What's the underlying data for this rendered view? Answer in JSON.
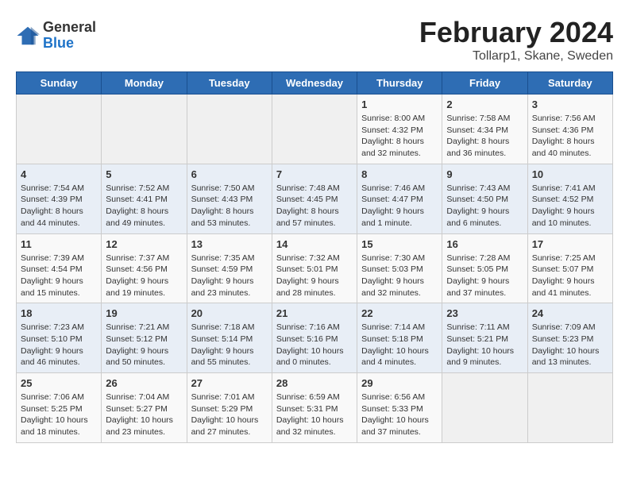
{
  "logo": {
    "general": "General",
    "blue": "Blue"
  },
  "title": "February 2024",
  "subtitle": "Tollarp1, Skane, Sweden",
  "headers": [
    "Sunday",
    "Monday",
    "Tuesday",
    "Wednesday",
    "Thursday",
    "Friday",
    "Saturday"
  ],
  "rows": [
    [
      {
        "day": "",
        "content": ""
      },
      {
        "day": "",
        "content": ""
      },
      {
        "day": "",
        "content": ""
      },
      {
        "day": "",
        "content": ""
      },
      {
        "day": "1",
        "content": "Sunrise: 8:00 AM\nSunset: 4:32 PM\nDaylight: 8 hours\nand 32 minutes."
      },
      {
        "day": "2",
        "content": "Sunrise: 7:58 AM\nSunset: 4:34 PM\nDaylight: 8 hours\nand 36 minutes."
      },
      {
        "day": "3",
        "content": "Sunrise: 7:56 AM\nSunset: 4:36 PM\nDaylight: 8 hours\nand 40 minutes."
      }
    ],
    [
      {
        "day": "4",
        "content": "Sunrise: 7:54 AM\nSunset: 4:39 PM\nDaylight: 8 hours\nand 44 minutes."
      },
      {
        "day": "5",
        "content": "Sunrise: 7:52 AM\nSunset: 4:41 PM\nDaylight: 8 hours\nand 49 minutes."
      },
      {
        "day": "6",
        "content": "Sunrise: 7:50 AM\nSunset: 4:43 PM\nDaylight: 8 hours\nand 53 minutes."
      },
      {
        "day": "7",
        "content": "Sunrise: 7:48 AM\nSunset: 4:45 PM\nDaylight: 8 hours\nand 57 minutes."
      },
      {
        "day": "8",
        "content": "Sunrise: 7:46 AM\nSunset: 4:47 PM\nDaylight: 9 hours\nand 1 minute."
      },
      {
        "day": "9",
        "content": "Sunrise: 7:43 AM\nSunset: 4:50 PM\nDaylight: 9 hours\nand 6 minutes."
      },
      {
        "day": "10",
        "content": "Sunrise: 7:41 AM\nSunset: 4:52 PM\nDaylight: 9 hours\nand 10 minutes."
      }
    ],
    [
      {
        "day": "11",
        "content": "Sunrise: 7:39 AM\nSunset: 4:54 PM\nDaylight: 9 hours\nand 15 minutes."
      },
      {
        "day": "12",
        "content": "Sunrise: 7:37 AM\nSunset: 4:56 PM\nDaylight: 9 hours\nand 19 minutes."
      },
      {
        "day": "13",
        "content": "Sunrise: 7:35 AM\nSunset: 4:59 PM\nDaylight: 9 hours\nand 23 minutes."
      },
      {
        "day": "14",
        "content": "Sunrise: 7:32 AM\nSunset: 5:01 PM\nDaylight: 9 hours\nand 28 minutes."
      },
      {
        "day": "15",
        "content": "Sunrise: 7:30 AM\nSunset: 5:03 PM\nDaylight: 9 hours\nand 32 minutes."
      },
      {
        "day": "16",
        "content": "Sunrise: 7:28 AM\nSunset: 5:05 PM\nDaylight: 9 hours\nand 37 minutes."
      },
      {
        "day": "17",
        "content": "Sunrise: 7:25 AM\nSunset: 5:07 PM\nDaylight: 9 hours\nand 41 minutes."
      }
    ],
    [
      {
        "day": "18",
        "content": "Sunrise: 7:23 AM\nSunset: 5:10 PM\nDaylight: 9 hours\nand 46 minutes."
      },
      {
        "day": "19",
        "content": "Sunrise: 7:21 AM\nSunset: 5:12 PM\nDaylight: 9 hours\nand 50 minutes."
      },
      {
        "day": "20",
        "content": "Sunrise: 7:18 AM\nSunset: 5:14 PM\nDaylight: 9 hours\nand 55 minutes."
      },
      {
        "day": "21",
        "content": "Sunrise: 7:16 AM\nSunset: 5:16 PM\nDaylight: 10 hours\nand 0 minutes."
      },
      {
        "day": "22",
        "content": "Sunrise: 7:14 AM\nSunset: 5:18 PM\nDaylight: 10 hours\nand 4 minutes."
      },
      {
        "day": "23",
        "content": "Sunrise: 7:11 AM\nSunset: 5:21 PM\nDaylight: 10 hours\nand 9 minutes."
      },
      {
        "day": "24",
        "content": "Sunrise: 7:09 AM\nSunset: 5:23 PM\nDaylight: 10 hours\nand 13 minutes."
      }
    ],
    [
      {
        "day": "25",
        "content": "Sunrise: 7:06 AM\nSunset: 5:25 PM\nDaylight: 10 hours\nand 18 minutes."
      },
      {
        "day": "26",
        "content": "Sunrise: 7:04 AM\nSunset: 5:27 PM\nDaylight: 10 hours\nand 23 minutes."
      },
      {
        "day": "27",
        "content": "Sunrise: 7:01 AM\nSunset: 5:29 PM\nDaylight: 10 hours\nand 27 minutes."
      },
      {
        "day": "28",
        "content": "Sunrise: 6:59 AM\nSunset: 5:31 PM\nDaylight: 10 hours\nand 32 minutes."
      },
      {
        "day": "29",
        "content": "Sunrise: 6:56 AM\nSunset: 5:33 PM\nDaylight: 10 hours\nand 37 minutes."
      },
      {
        "day": "",
        "content": ""
      },
      {
        "day": "",
        "content": ""
      }
    ]
  ]
}
